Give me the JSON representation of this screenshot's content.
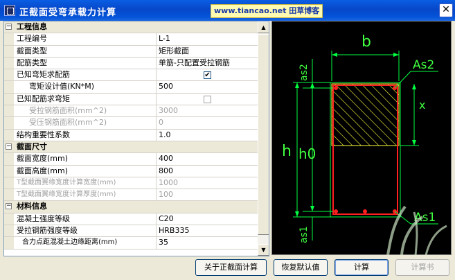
{
  "window": {
    "title": "正截面受弯承载力计算",
    "site_badge": "www.tiancao.net 田草博客",
    "close_label": "✕"
  },
  "properties": [
    {
      "kind": "category",
      "label": "工程信息",
      "toggle": "−"
    },
    {
      "kind": "item",
      "label": "工程编号",
      "value": "L-1"
    },
    {
      "kind": "item",
      "label": "截面类型",
      "value": "矩形截面"
    },
    {
      "kind": "item",
      "label": "配筋类型",
      "value": "单筋-只配置受拉钢筋"
    },
    {
      "kind": "check",
      "label": "已知弯矩求配筋",
      "checked": "✔"
    },
    {
      "kind": "sub",
      "label": "弯矩设计值(KN*M)",
      "value": "500"
    },
    {
      "kind": "check-off",
      "label": "已知配筋求弯矩",
      "checked": ""
    },
    {
      "kind": "sub-dis",
      "label": "受拉钢筋面积(mm^2)",
      "value": "3000"
    },
    {
      "kind": "sub-dis",
      "label": "受压钢筋面积(mm^2)",
      "value": "0"
    },
    {
      "kind": "item",
      "label": "结构重要性系数",
      "value": "1.0"
    },
    {
      "kind": "category",
      "label": "截面尺寸",
      "toggle": "−"
    },
    {
      "kind": "item",
      "label": "截面宽度(mm)",
      "value": "400"
    },
    {
      "kind": "item",
      "label": "截面高度(mm)",
      "value": "800"
    },
    {
      "kind": "item-dis",
      "label": "T型截面翼缘宽度计算宽度(mm)",
      "value": "1000"
    },
    {
      "kind": "item-dis",
      "label": "T型截面翼缘宽度计算厚度(mm)",
      "value": "100"
    },
    {
      "kind": "category",
      "label": "材料信息",
      "toggle": "−"
    },
    {
      "kind": "item",
      "label": "混凝土强度等级",
      "value": "C20"
    },
    {
      "kind": "item",
      "label": "受拉钢筋强度等级",
      "value": "HRB335"
    },
    {
      "kind": "sub2",
      "label": "合力点距混凝土边缘距离(mm)",
      "value": "35"
    }
  ],
  "scrollbar": {
    "up": "▲",
    "down": "▼"
  },
  "diagram": {
    "b": "b",
    "as2": "As2",
    "as1": "As1",
    "x": "x",
    "h": "h",
    "h0": "h0",
    "as_top": "as2",
    "as_bot": "as1"
  },
  "buttons": {
    "about": "关于正截面计算",
    "restore": "恢复默认值",
    "calc": "计算",
    "report": "计算书"
  },
  "colors": {
    "title_bar": "#0a5ee3",
    "drawing_bg": "#000000",
    "dim_green": "#00ff40",
    "section_red": "#ff2020",
    "hatch_yellow": "#ffff40",
    "label_green": "#40ff40"
  }
}
